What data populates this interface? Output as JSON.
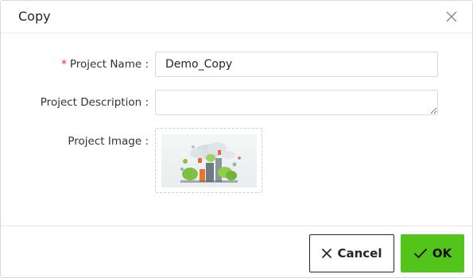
{
  "dialog": {
    "title": "Copy",
    "close_icon": "close-icon"
  },
  "form": {
    "name_label": "Project Name :",
    "name_required_mark": "*",
    "name_value": "Demo_Copy",
    "description_label": "Project Description :",
    "description_value": "",
    "image_label": "Project Image :",
    "image_icon": "project-thumbnail-image"
  },
  "footer": {
    "cancel_label": "Cancel",
    "cancel_icon": "close-icon",
    "ok_label": "OK",
    "ok_icon": "check-icon"
  },
  "colors": {
    "accent_green": "#52c41a",
    "required_red": "#f5222d",
    "border": "#d9d9d9"
  }
}
